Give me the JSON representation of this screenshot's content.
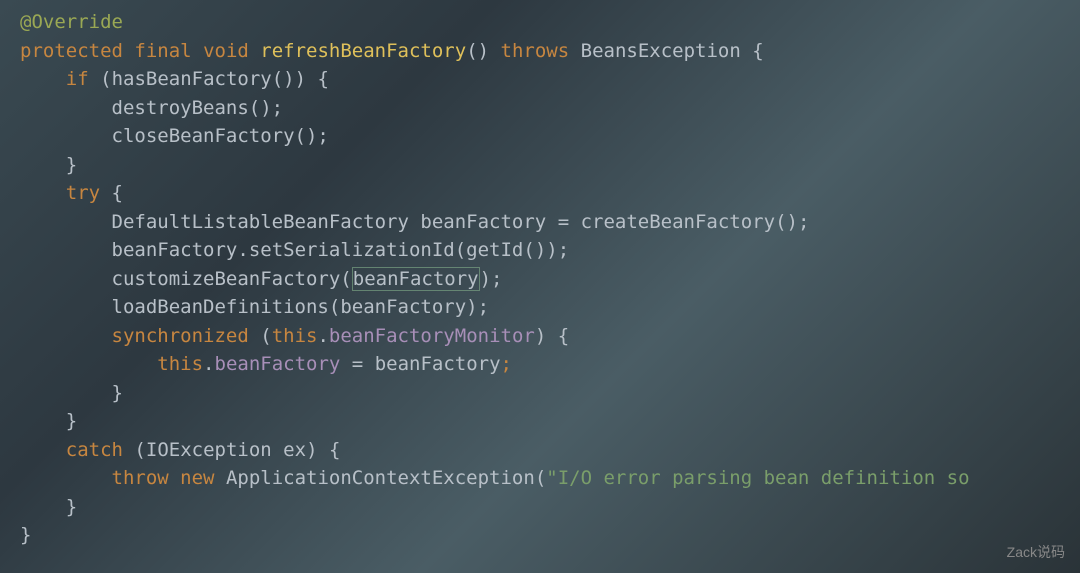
{
  "code": {
    "line1": {
      "annotation": "@Override"
    },
    "line2": {
      "kw_protected": "protected",
      "kw_final": "final",
      "kw_void": "void",
      "method": "refreshBeanFactory",
      "parens": "()",
      "kw_throws": "throws",
      "exception": "BeansException",
      "brace": "{"
    },
    "line3": {
      "kw_if": "if",
      "open_paren": "(",
      "method": "hasBeanFactory",
      "close": "())",
      "brace": "{"
    },
    "line4": {
      "method": "destroyBeans",
      "parens": "();"
    },
    "line5": {
      "method": "closeBeanFactory",
      "parens": "();"
    },
    "line6": {
      "brace": "}"
    },
    "line7": {
      "kw_try": "try",
      "brace": "{"
    },
    "line8": {
      "type": "DefaultListableBeanFactory",
      "var": "beanFactory",
      "eq": "=",
      "method": "createBeanFactory",
      "parens": "();"
    },
    "line9": {
      "var": "beanFactory",
      "dot": ".",
      "method": "setSerializationId",
      "open": "(",
      "inner_method": "getId",
      "close": "());"
    },
    "line10": {
      "method": "customizeBeanFactory",
      "open": "(",
      "arg": "beanFactory",
      "close": ");"
    },
    "line11": {
      "method": "loadBeanDefinitions",
      "open": "(",
      "arg": "beanFactory",
      "close": ");"
    },
    "line12": {
      "kw_sync": "synchronized",
      "open": "(",
      "kw_this": "this",
      "dot": ".",
      "field": "beanFactoryMonitor",
      "close": ")",
      "brace": "{"
    },
    "line13": {
      "kw_this": "this",
      "dot": ".",
      "field": "beanFactory",
      "eq": "=",
      "var": "beanFactory",
      "semi": ";"
    },
    "line14": {
      "brace": "}"
    },
    "line15": {
      "brace": "}"
    },
    "line16": {
      "kw_catch": "catch",
      "open": "(",
      "type": "IOException",
      "var": "ex",
      "close": ")",
      "brace": "{"
    },
    "line17": {
      "kw_throw": "throw",
      "kw_new": "new",
      "type": "ApplicationContextException",
      "open": "(",
      "string": "\"I/O error parsing bean definition so"
    },
    "line18": {
      "brace": "}"
    },
    "line19": {
      "brace": "}"
    }
  },
  "watermark": "Zack说码"
}
